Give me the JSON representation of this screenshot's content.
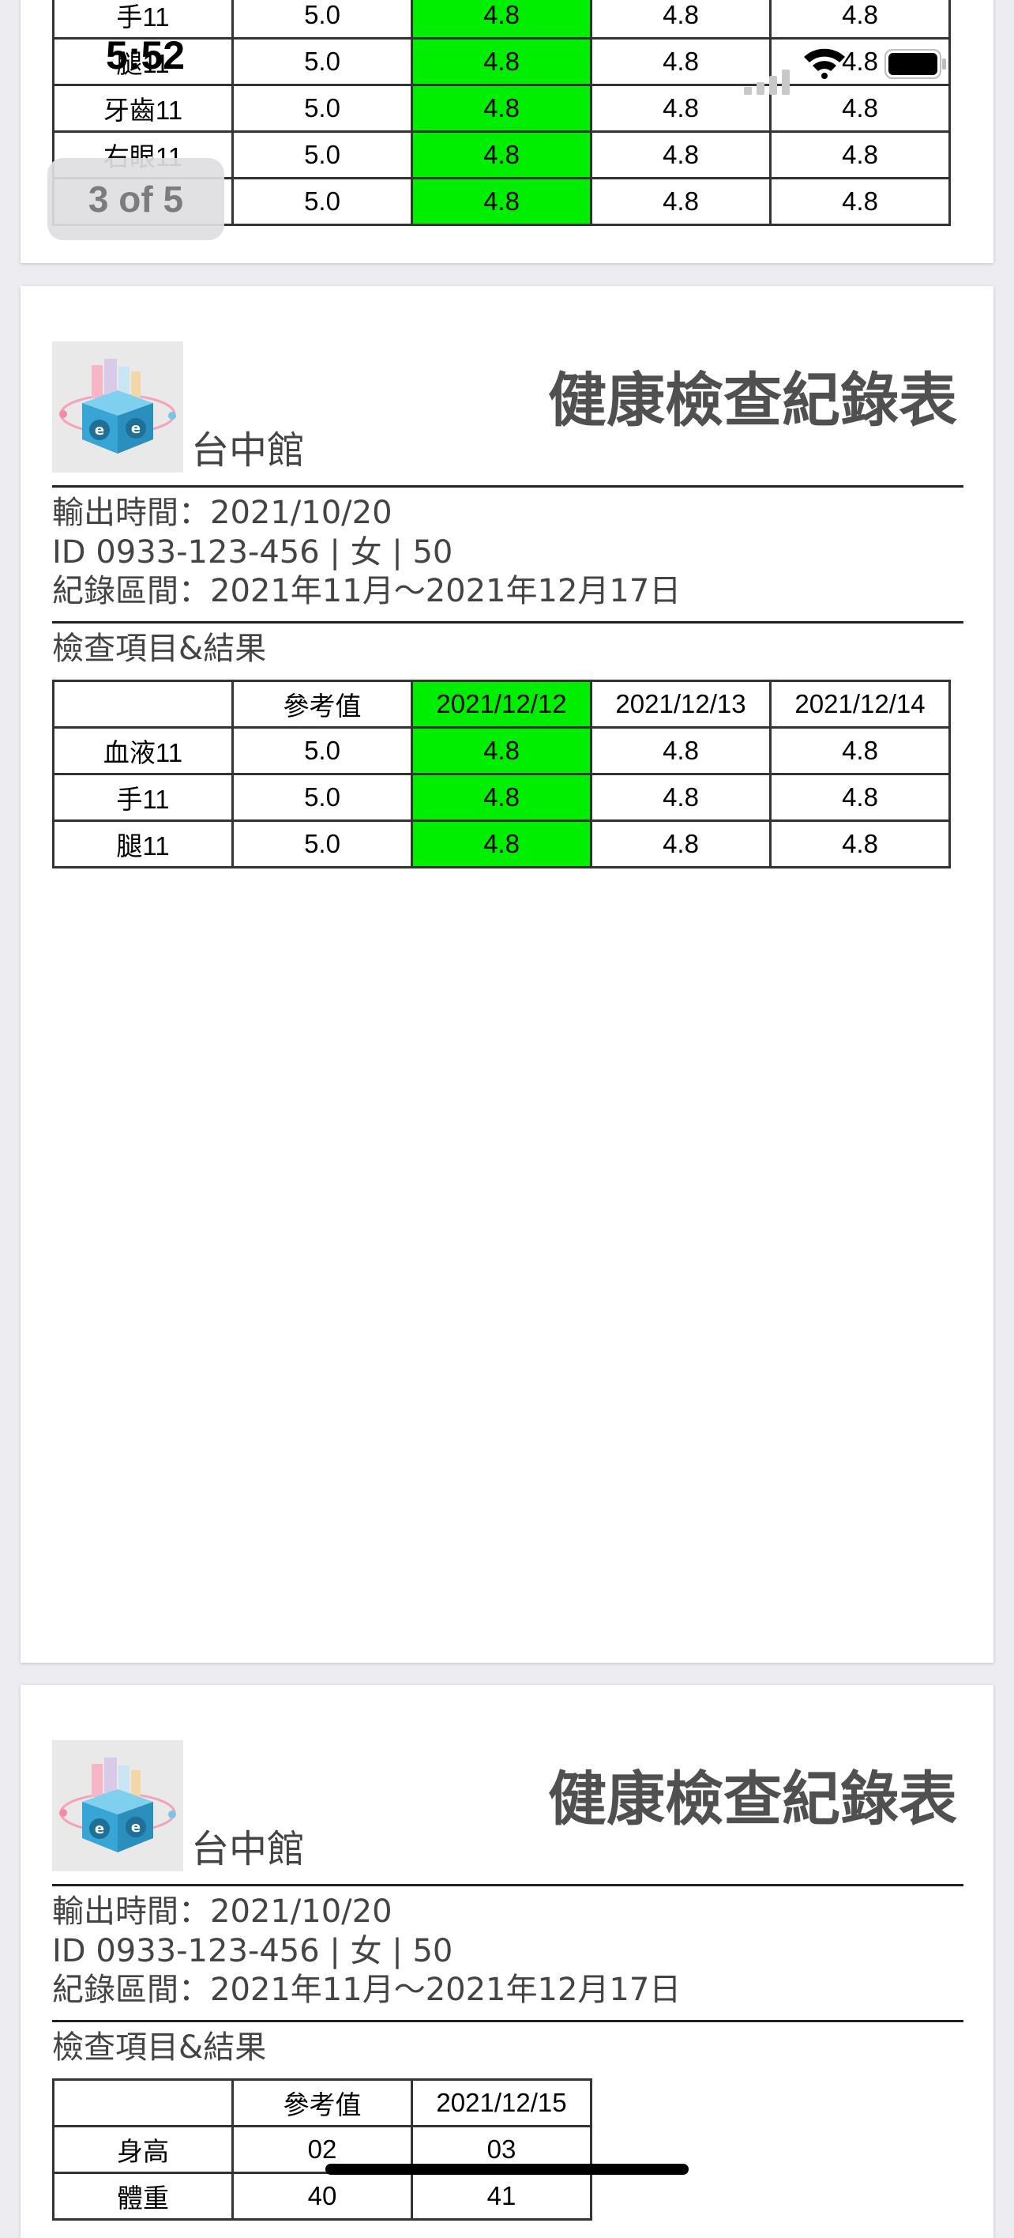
{
  "status_bar": {
    "time": "5:52"
  },
  "pager": {
    "current": 3,
    "total": 5,
    "label": "3 of 5"
  },
  "report": {
    "location": "台中館",
    "title": "健康檢查紀錄表",
    "export_time": "輸出時間：2021/10/20",
    "id_line": "ID 0933-123-456 | 女 | 50",
    "record_range": "紀錄區間：2021年11月～2021年12月17日",
    "section_label": "檢查項目&結果",
    "highlight_color": "#00ee00"
  },
  "top_table": {
    "rows": [
      [
        "手11",
        "5.0",
        "4.8",
        "4.8",
        "4.8"
      ],
      [
        "腿11",
        "5.0",
        "4.8",
        "4.8",
        "4.8"
      ],
      [
        "牙齒11",
        "5.0",
        "4.8",
        "4.8",
        "4.8"
      ],
      [
        "右眼11",
        "5.0",
        "4.8",
        "4.8",
        "4.8"
      ],
      [
        "",
        "5.0",
        "4.8",
        "4.8",
        "4.8"
      ]
    ]
  },
  "page_1_table": {
    "header": [
      "",
      "參考值",
      "2021/12/12",
      "2021/12/13",
      "2021/12/14"
    ],
    "rows": [
      [
        "血液11",
        "5.0",
        "4.8",
        "4.8",
        "4.8"
      ],
      [
        "手11",
        "5.0",
        "4.8",
        "4.8",
        "4.8"
      ],
      [
        "腿11",
        "5.0",
        "4.8",
        "4.8",
        "4.8"
      ]
    ]
  },
  "page_2_table": {
    "header": [
      "",
      "參考值",
      "2021/12/15"
    ],
    "rows": [
      [
        "身高",
        "02",
        "03"
      ],
      [
        "體重",
        "40",
        "41"
      ]
    ]
  }
}
